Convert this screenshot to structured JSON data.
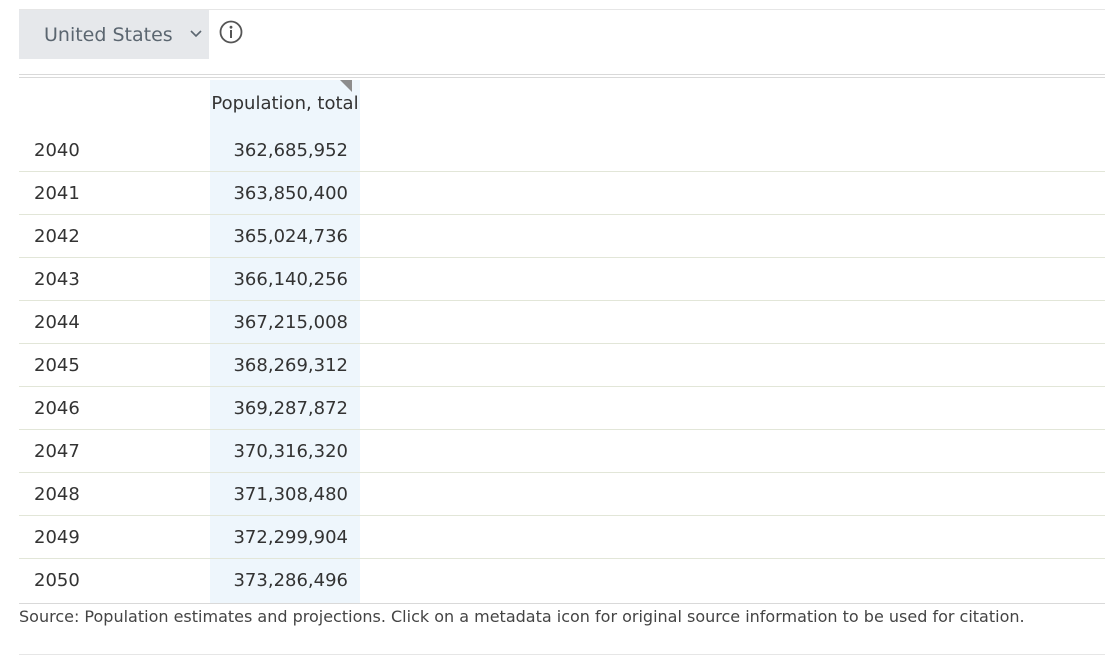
{
  "country_select": {
    "value": "United States"
  },
  "table": {
    "column_header": "Population, total",
    "rows": [
      {
        "year": "2040",
        "value": "362,685,952"
      },
      {
        "year": "2041",
        "value": "363,850,400"
      },
      {
        "year": "2042",
        "value": "365,024,736"
      },
      {
        "year": "2043",
        "value": "366,140,256"
      },
      {
        "year": "2044",
        "value": "367,215,008"
      },
      {
        "year": "2045",
        "value": "368,269,312"
      },
      {
        "year": "2046",
        "value": "369,287,872"
      },
      {
        "year": "2047",
        "value": "370,316,320"
      },
      {
        "year": "2048",
        "value": "371,308,480"
      },
      {
        "year": "2049",
        "value": "372,299,904"
      },
      {
        "year": "2050",
        "value": "373,286,496"
      }
    ]
  },
  "source_note": "Source: Population estimates and projections. Click on a metadata icon for original source information to be used for citation.",
  "icons": [
    "chevron-down-icon",
    "info-icon"
  ]
}
